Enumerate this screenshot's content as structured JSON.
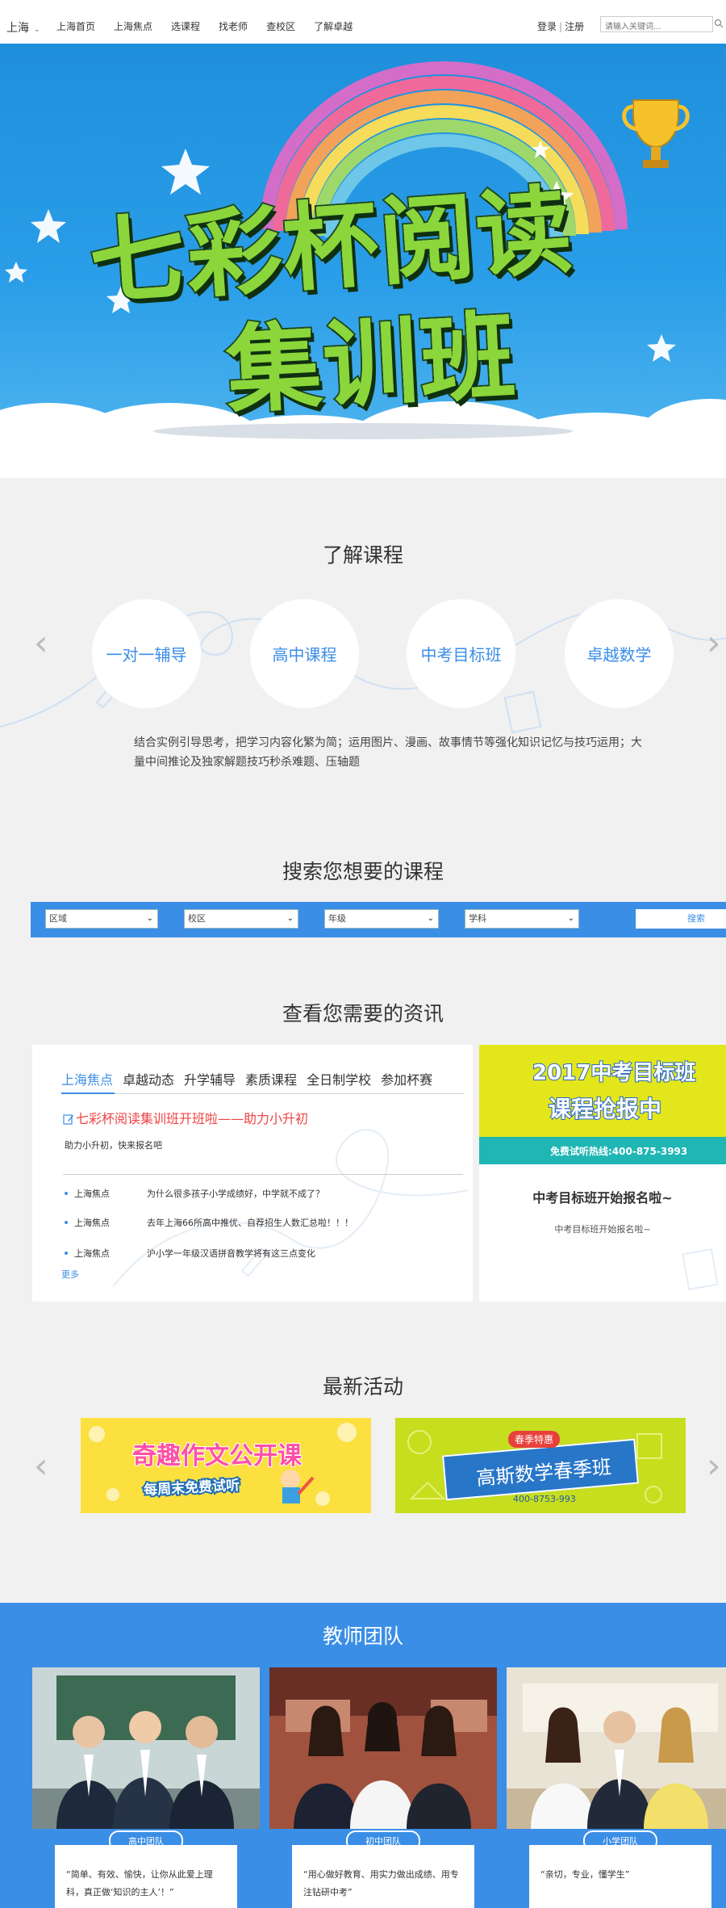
{
  "header": {
    "city": "上海",
    "nav": [
      "上海首页",
      "上海焦点",
      "选课程",
      "找老师",
      "查校区",
      "了解卓越"
    ],
    "login": "登录",
    "register": "注册",
    "search_placeholder": "请输入关键词..."
  },
  "banner": {
    "line1": "七彩杯阅读",
    "line2": "集训班"
  },
  "courses": {
    "title": "了解课程",
    "items": [
      "一对一辅导",
      "高中课程",
      "中考目标班",
      "卓越数学"
    ],
    "description": "结合实例引导思考，把学习内容化繁为简；运用图片、漫画、故事情节等强化知识记忆与技巧运用；大量中间推论及独家解题技巧秒杀难题、压轴题"
  },
  "search": {
    "title": "搜索您想要的课程",
    "filters": [
      "区域",
      "校区",
      "年级",
      "学科"
    ],
    "button": "搜索"
  },
  "news": {
    "title": "查看您需要的资讯",
    "tabs": [
      "上海焦点",
      "卓越动态",
      "升学辅导",
      "素质课程",
      "全日制学校",
      "参加杯赛"
    ],
    "headline": "七彩杯阅读集训班开班啦——助力小升初",
    "sub": "助力小升初，快来报名吧",
    "items": [
      {
        "cat": "上海焦点",
        "text": "为什么很多孩子小学成绩好，中学就不成了？"
      },
      {
        "cat": "上海焦点",
        "text": "去年上海66所高中推优、自荐招生人数汇总啦！！！"
      },
      {
        "cat": "上海焦点",
        "text": "沪小学一年级汉语拼音教学将有这三点变化"
      }
    ],
    "more": "更多",
    "promo": {
      "img_line1": "2017中考目标班",
      "img_line2": "课程抢报中",
      "img_line3": "免费试听热线:400-875-3993",
      "title": "中考目标班开始报名啦~",
      "sub": "中考目标班开始报名啦~"
    }
  },
  "activities": {
    "title": "最新活动",
    "a1_main": "奇趣作文公开课",
    "a1_sub": "每周末免费试听",
    "a2_badge": "春季特惠",
    "a2_main": "高斯数学春季班",
    "a2_phone": "400-8753-993"
  },
  "teachers": {
    "title": "教师团队",
    "cards": [
      {
        "badge": "高中团队",
        "quote": "“简单、有效、愉快，让你从此爱上理科，真正做‘知识的主人’！”"
      },
      {
        "badge": "初中团队",
        "quote": "“用心做好教育、用实力做出成绩、用专注钻研中考”"
      },
      {
        "badge": "小学团队",
        "quote": "“亲切，专业，懂学生”"
      }
    ]
  },
  "colors": {
    "accent": "#3a8ee6",
    "headline": "#e44444"
  }
}
